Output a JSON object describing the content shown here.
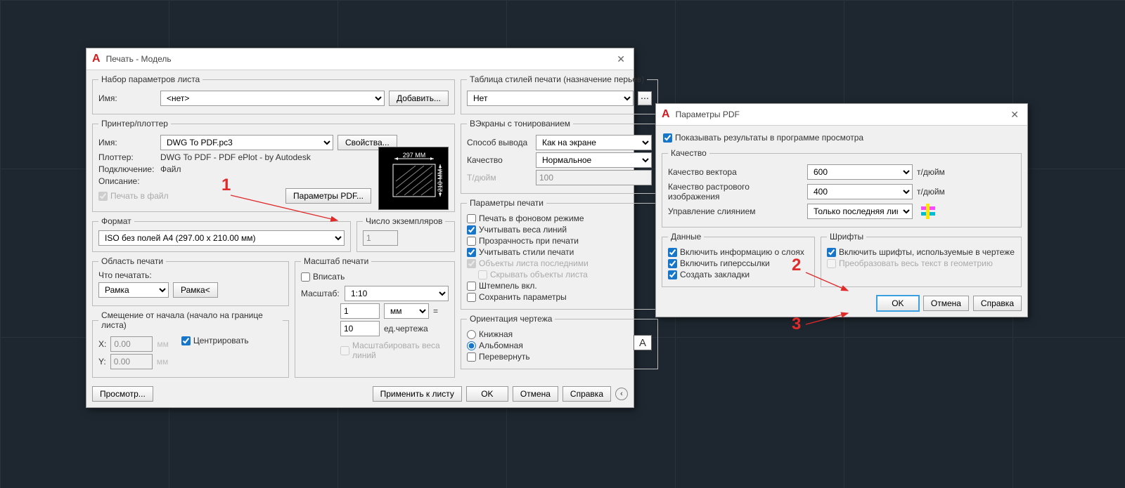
{
  "plot": {
    "title": "Печать - Модель",
    "groups": {
      "pageset": "Набор параметров листа",
      "printer": "Принтер/плоттер",
      "format": "Формат",
      "copies": "Число экземпляров",
      "area": "Область печати",
      "scale": "Масштаб печати",
      "offset": "Смещение от начала (начало на границе листа)",
      "styletable": "Таблица стилей печати (назначение перьев)",
      "viewports": "ВЭкраны с тонированием",
      "options": "Параметры печати",
      "orient": "Ориентация чертежа"
    },
    "labels": {
      "name": "Имя:",
      "plotter": "Плоттер:",
      "connection": "Подключение:",
      "description": "Описание:",
      "what": "Что печатать:",
      "scale": "Масштаб:",
      "x": "X:",
      "y": "Y:",
      "outmode": "Способ вывода",
      "quality": "Качество",
      "dpi": "Т/дюйм",
      "eq": "=",
      "mm": "мм",
      "units": "ед.чертежа",
      "mmdim": "мм"
    },
    "values": {
      "pageset_name": "<нет>",
      "plotter_name": "DWG To PDF.pc3",
      "plotter_desc": "DWG To PDF - PDF ePlot - by Autodesk",
      "connection": "Файл",
      "format": "ISO без полей A4 (297.00 x 210.00 мм)",
      "copies": "1",
      "area_mode": "Рамка",
      "scale_preset": "1:10",
      "scale_a": "1",
      "scale_units": "мм",
      "scale_b": "10",
      "offset_x": "0.00",
      "offset_y": "0.00",
      "styletable": "Нет",
      "outmode": "Как на экране",
      "quality": "Нормальное",
      "dpi": "100",
      "preview_w": "297 MM",
      "preview_h": "210 MM"
    },
    "buttons": {
      "add": "Добавить...",
      "props": "Свойства...",
      "pdfopts": "Параметры PDF...",
      "window": "Рамка<",
      "preview": "Просмотр...",
      "applylayout": "Применить к листу",
      "ok": "OK",
      "cancel": "Отмена",
      "help": "Справка"
    },
    "checks": {
      "plottofile": "Печать в файл",
      "fit": "Вписать",
      "scaleweights": "Масштабировать веса линий",
      "center": "Центрировать",
      "bg": "Печать в фоновом режиме",
      "weights": "Учитывать веса линий",
      "transparency": "Прозрачность при печати",
      "styles": "Учитывать стили печати",
      "paperspace": "Объекты листа последними",
      "hide": "Скрывать объекты листа",
      "stamp": "Штемпель вкл.",
      "save": "Сохранить параметры"
    },
    "radios": {
      "portrait": "Книжная",
      "landscape": "Альбомная",
      "upsidedown": "Перевернуть"
    }
  },
  "pdf": {
    "title": "Параметры PDF",
    "checks": {
      "showresults": "Показывать результаты в программе просмотра",
      "layers": "Включить информацию о слоях",
      "hyperlinks": "Включить гиперссылки",
      "bookmarks": "Создать закладки",
      "capturefonts": "Включить шрифты, используемые в чертеже",
      "textgeom": "Преобразовать весь текст в геометрию"
    },
    "groups": {
      "quality": "Качество",
      "data": "Данные",
      "fonts": "Шрифты"
    },
    "labels": {
      "vectordpi": "Качество вектора",
      "rasterdpi": "Качество растрового изображения",
      "merge": "Управление слиянием",
      "tdpi": "т/дюйм"
    },
    "values": {
      "vectordpi": "600",
      "rasterdpi": "400",
      "merge": "Только последняя линия"
    },
    "buttons": {
      "ok": "OK",
      "cancel": "Отмена",
      "help": "Справка"
    }
  },
  "annotations": {
    "n1": "1",
    "n2": "2",
    "n3": "3"
  }
}
